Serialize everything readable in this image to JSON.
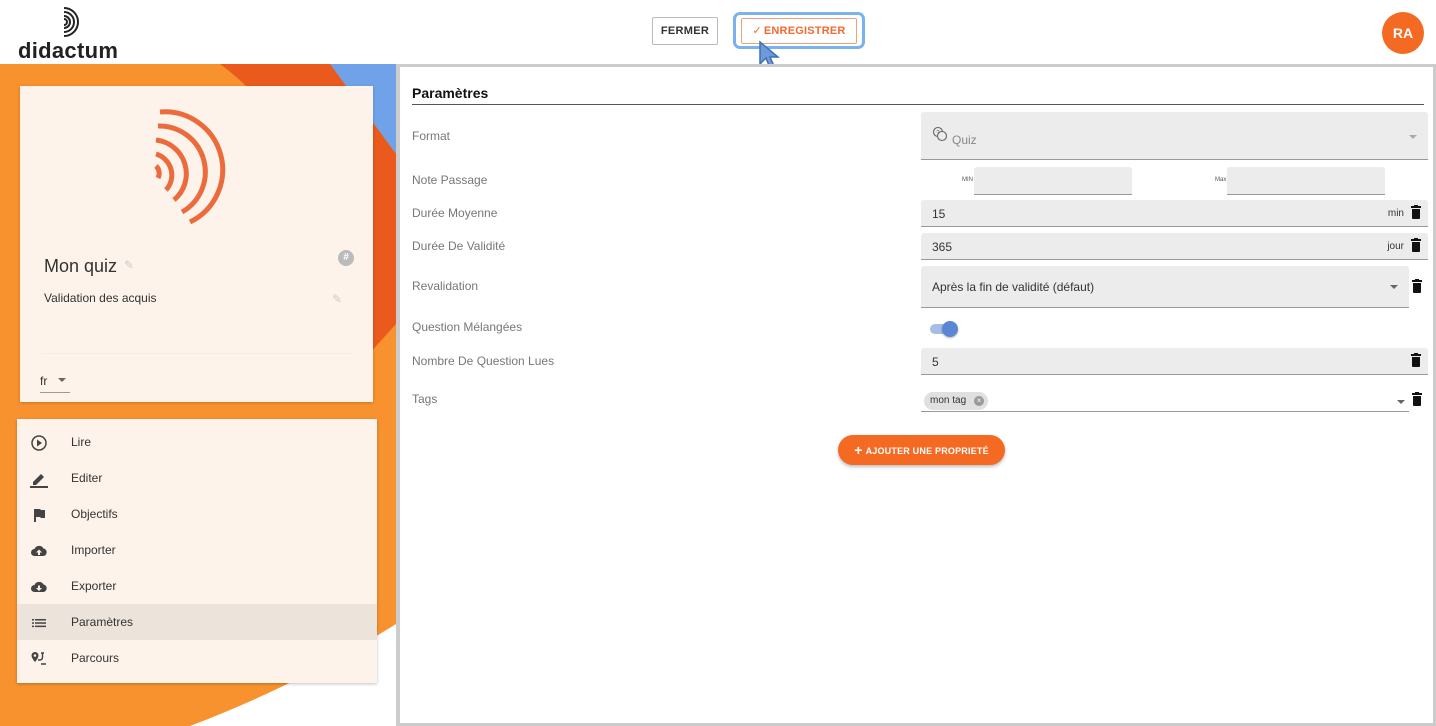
{
  "brand": {
    "name": "didactum",
    "accent": "#f46a23"
  },
  "toolbar": {
    "close_label": "FERMER",
    "save_label": "ENREGISTRER"
  },
  "user": {
    "initials": "RA"
  },
  "quiz": {
    "title": "Mon quiz",
    "subtitle": "Validation des acquis",
    "hash_icon": "#",
    "language": "fr"
  },
  "menu": {
    "items": [
      {
        "label": "Lire",
        "icon": "play-circle-icon"
      },
      {
        "label": "Editer",
        "icon": "pencil-icon"
      },
      {
        "label": "Objectifs",
        "icon": "flag-icon"
      },
      {
        "label": "Importer",
        "icon": "cloud-upload-icon"
      },
      {
        "label": "Exporter",
        "icon": "cloud-download-icon"
      },
      {
        "label": "Paramètres",
        "icon": "list-icon",
        "active": true
      },
      {
        "label": "Parcours",
        "icon": "route-icon"
      }
    ]
  },
  "settings": {
    "title": "Paramètres",
    "format": {
      "label": "Format",
      "value": "Quiz"
    },
    "passing_grade": {
      "label": "Note Passage",
      "min_label": "MIN",
      "max_label": "Max",
      "min_value": "",
      "max_value": ""
    },
    "average_duration": {
      "label": "Durée Moyenne",
      "value": "15",
      "unit": "min"
    },
    "validity_duration": {
      "label": "Durée De Validité",
      "value": "365",
      "unit": "jour"
    },
    "revalidation": {
      "label": "Revalidation",
      "value": "Après la fin de validité (défaut)"
    },
    "shuffled_questions": {
      "label": "Question Mélangées",
      "enabled": true
    },
    "questions_read": {
      "label": "Nombre De Question Lues",
      "value": "5"
    },
    "tags": {
      "label": "Tags",
      "items": [
        "mon tag"
      ]
    },
    "add_property_label": "AJOUTER UNE PROPRIETÉ"
  }
}
